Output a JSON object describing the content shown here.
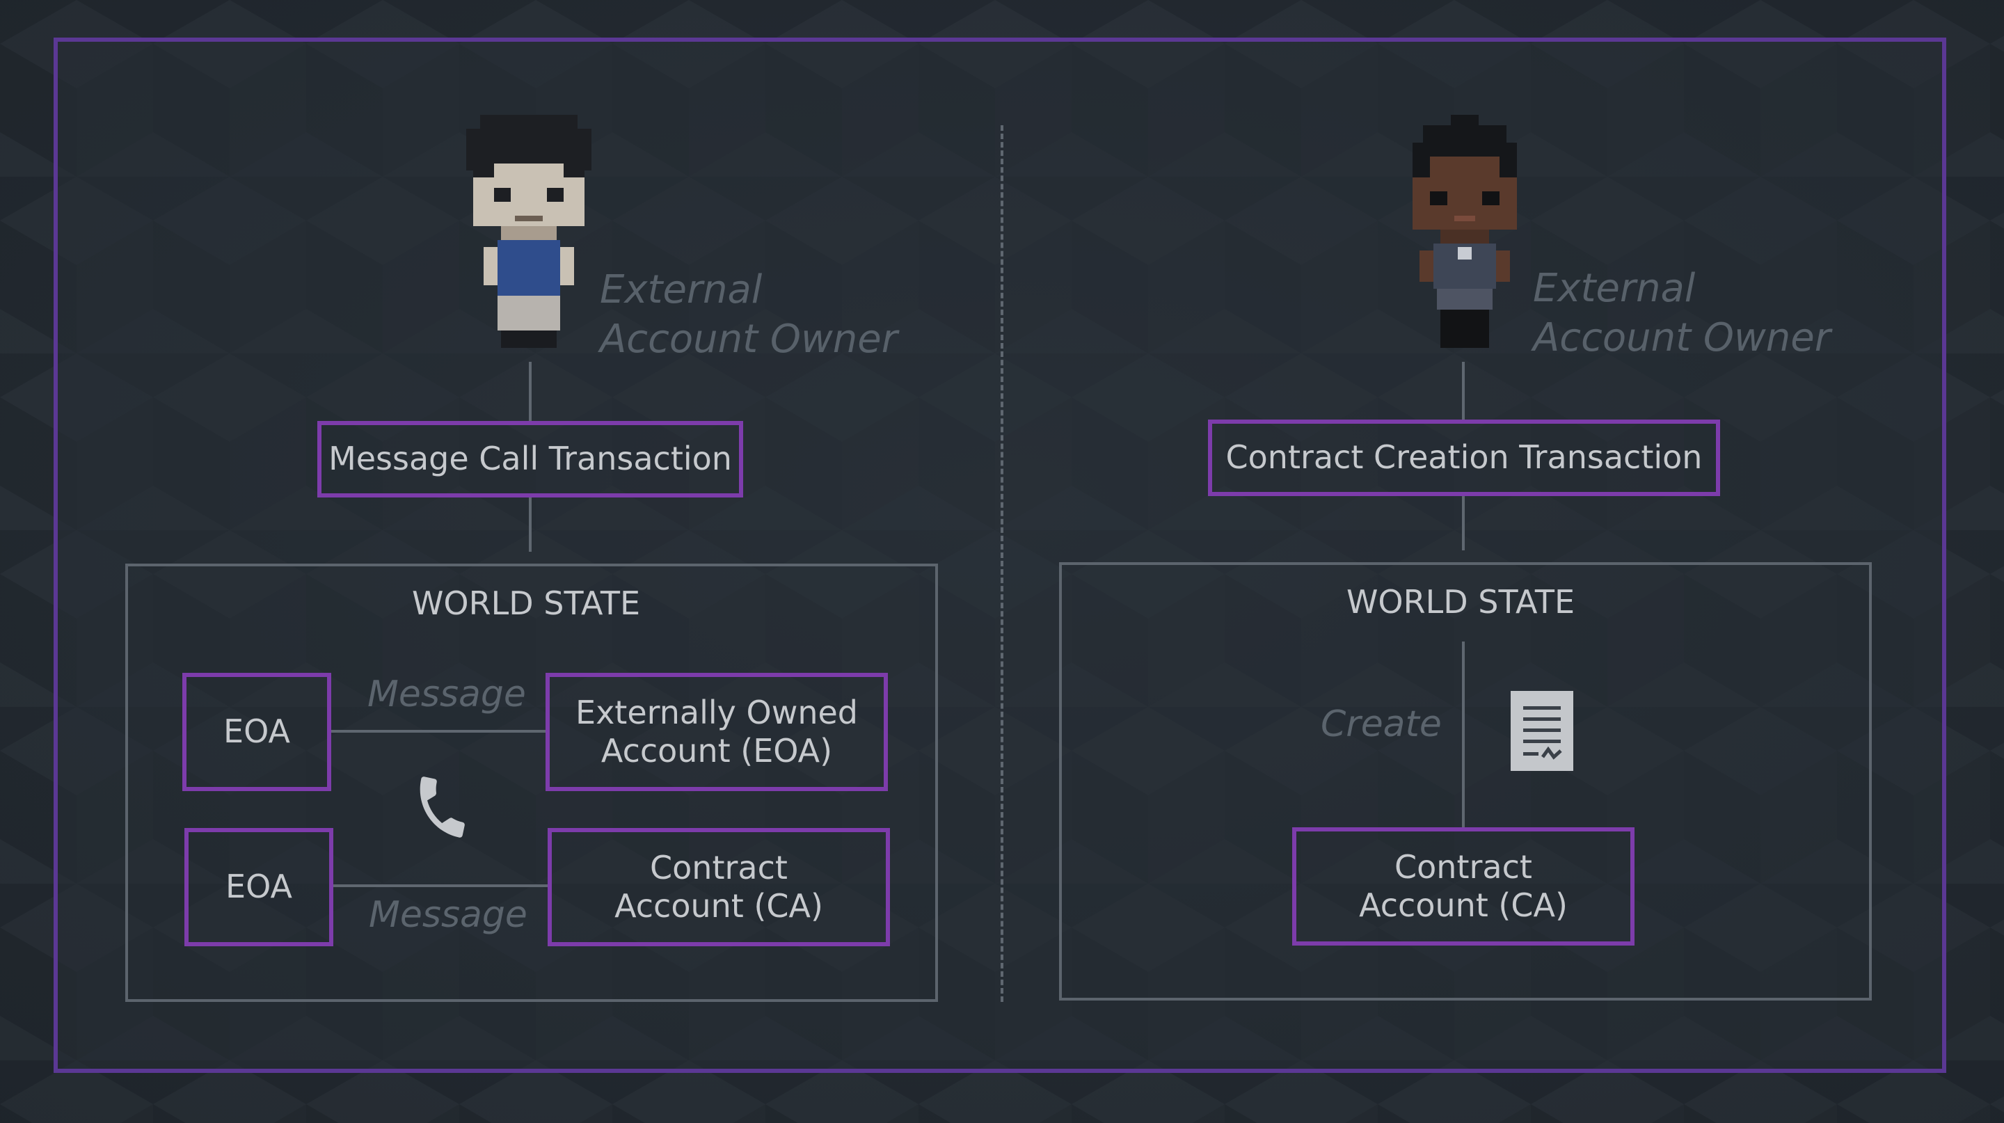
{
  "left": {
    "owner_label_line1": "External",
    "owner_label_line2": "Account Owner",
    "transaction": "Message Call Transaction",
    "world_state": "WORLD STATE",
    "eoa_1": "EOA",
    "eoa_2": "EOA",
    "message_top": "Message",
    "message_bottom": "Message",
    "target_eoa": "Externally Owned\nAccount (EOA)",
    "target_ca": "Contract\nAccount (CA)"
  },
  "right": {
    "owner_label_line1": "External",
    "owner_label_line2": "Account Owner",
    "transaction": "Contract Creation Transaction",
    "world_state": "WORLD STATE",
    "create": "Create",
    "contract_account": "Contract\nAccount (CA)"
  },
  "icons": {
    "left_avatar": "pixel-person-light-icon",
    "right_avatar": "pixel-person-dark-icon",
    "phone": "phone-icon",
    "contract_doc": "contract-document-icon"
  },
  "colors": {
    "frame": "#5b3894",
    "box_border": "#7d3cab",
    "text": "#c6c9cd",
    "muted_text": "#58616a"
  }
}
